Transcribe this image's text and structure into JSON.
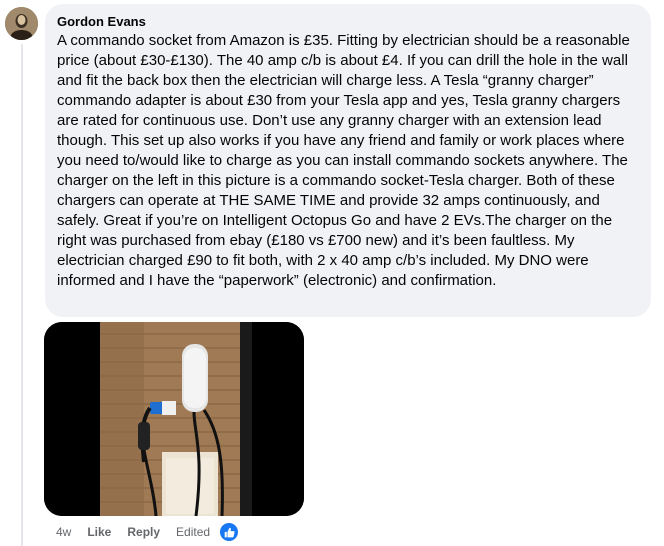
{
  "comment": {
    "author": "Gordon Evans",
    "text": "A commando socket from Amazon is £35. Fitting by electrician should be a reasonable price (about £30-£130). The 40 amp c/b is about £4. If you can drill the hole in the wall and fit the back box then the electrician will charge less. A Tesla “granny charger” commando adapter is about £30 from your Tesla app and yes, Tesla granny chargers are rated for continuous use. Don’t use any granny charger with an extension lead though. This set up also works if you have any friend and family or work places where you need to/would like to charge as you can install commando sockets anywhere. The charger on the left in this picture is a commando socket-Tesla charger. Both of these chargers can operate at THE SAME TIME and provide 32 amps continuously, and safely. Great if you’re on Intelligent Octopus Go and have 2 EVs.The charger on the right was purchased from ebay (£180 vs £700 new) and it’s been faultless. My electrician charged £90 to fit both, with 2 x 40 amp c/b’s included. My DNO were informed and I have the “paperwork” (electronic) and confirmation."
  },
  "actions": {
    "time": "4w",
    "like": "Like",
    "reply": "Reply",
    "edited": "Edited"
  },
  "reaction_icon": "thumbs-up-icon",
  "colors": {
    "bubble": "#f0f2f5",
    "meta_text": "#65676b",
    "like_blue": "#1877f2"
  }
}
